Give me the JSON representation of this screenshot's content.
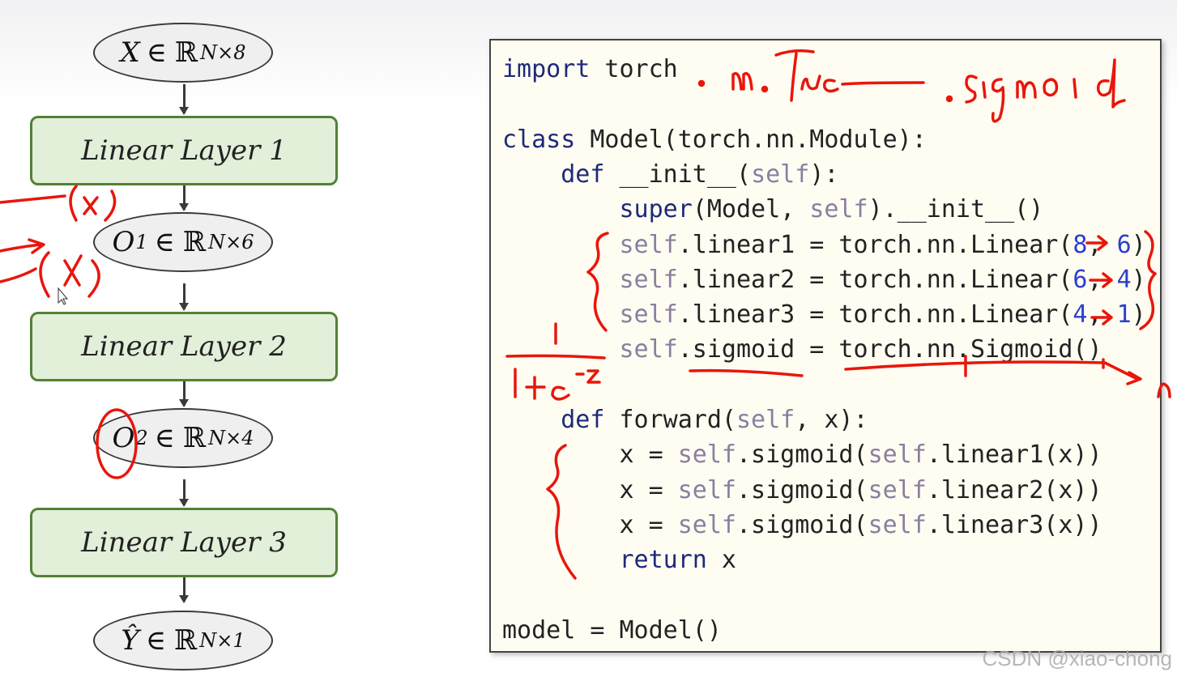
{
  "diagram": {
    "nodes": [
      {
        "symbol": "X",
        "exp_sup": "",
        "set": "ℝ",
        "dims": "N×8"
      },
      {
        "symbol": "O",
        "exp_sup": "1",
        "set": "ℝ",
        "dims": "N×6"
      },
      {
        "symbol": "O",
        "exp_sup": "2",
        "set": "ℝ",
        "dims": "N×4"
      },
      {
        "symbol": "Ŷ",
        "exp_sup": "",
        "set": "ℝ",
        "dims": "N×1"
      }
    ],
    "elem_symbol": "∈",
    "layers": [
      "Linear Layer 1",
      "Linear Layer 2",
      "Linear Layer 3"
    ]
  },
  "code": {
    "lines": [
      [
        {
          "t": "import",
          "c": "kw"
        },
        {
          "t": " torch",
          "c": ""
        }
      ],
      [],
      [
        {
          "t": "class",
          "c": "kw"
        },
        {
          "t": " Model(torch.nn.Module):",
          "c": ""
        }
      ],
      [
        {
          "t": "    ",
          "c": ""
        },
        {
          "t": "def",
          "c": "kw"
        },
        {
          "t": " __init__(",
          "c": ""
        },
        {
          "t": "self",
          "c": "slf"
        },
        {
          "t": "):",
          "c": ""
        }
      ],
      [
        {
          "t": "        ",
          "c": ""
        },
        {
          "t": "super",
          "c": "kw"
        },
        {
          "t": "(Model, ",
          "c": ""
        },
        {
          "t": "self",
          "c": "slf"
        },
        {
          "t": ").__init__()",
          "c": ""
        }
      ],
      [
        {
          "t": "        ",
          "c": ""
        },
        {
          "t": "self",
          "c": "slf"
        },
        {
          "t": ".linear1 = torch.nn.Linear(",
          "c": ""
        },
        {
          "t": "8",
          "c": "num"
        },
        {
          "t": ", ",
          "c": ""
        },
        {
          "t": "6",
          "c": "num"
        },
        {
          "t": ")",
          "c": ""
        }
      ],
      [
        {
          "t": "        ",
          "c": ""
        },
        {
          "t": "self",
          "c": "slf"
        },
        {
          "t": ".linear2 = torch.nn.Linear(",
          "c": ""
        },
        {
          "t": "6",
          "c": "num"
        },
        {
          "t": ", ",
          "c": ""
        },
        {
          "t": "4",
          "c": "num"
        },
        {
          "t": ")",
          "c": ""
        }
      ],
      [
        {
          "t": "        ",
          "c": ""
        },
        {
          "t": "self",
          "c": "slf"
        },
        {
          "t": ".linear3 = torch.nn.Linear(",
          "c": ""
        },
        {
          "t": "4",
          "c": "num"
        },
        {
          "t": ", ",
          "c": ""
        },
        {
          "t": "1",
          "c": "num"
        },
        {
          "t": ")",
          "c": ""
        }
      ],
      [
        {
          "t": "        ",
          "c": ""
        },
        {
          "t": "self",
          "c": "slf"
        },
        {
          "t": ".sigmoid = torch.nn.Sigmoid()",
          "c": ""
        }
      ],
      [],
      [
        {
          "t": "    ",
          "c": ""
        },
        {
          "t": "def",
          "c": "kw"
        },
        {
          "t": " forward(",
          "c": ""
        },
        {
          "t": "self",
          "c": "slf"
        },
        {
          "t": ", x):",
          "c": ""
        }
      ],
      [
        {
          "t": "        x = ",
          "c": ""
        },
        {
          "t": "self",
          "c": "slf"
        },
        {
          "t": ".sigmoid(",
          "c": ""
        },
        {
          "t": "self",
          "c": "slf"
        },
        {
          "t": ".linear1(x))",
          "c": ""
        }
      ],
      [
        {
          "t": "        x = ",
          "c": ""
        },
        {
          "t": "self",
          "c": "slf"
        },
        {
          "t": ".sigmoid(",
          "c": ""
        },
        {
          "t": "self",
          "c": "slf"
        },
        {
          "t": ".linear2(x))",
          "c": ""
        }
      ],
      [
        {
          "t": "        x = ",
          "c": ""
        },
        {
          "t": "self",
          "c": "slf"
        },
        {
          "t": ".sigmoid(",
          "c": ""
        },
        {
          "t": "self",
          "c": "slf"
        },
        {
          "t": ".linear3(x))",
          "c": ""
        }
      ],
      [
        {
          "t": "        ",
          "c": ""
        },
        {
          "t": "return",
          "c": "kw"
        },
        {
          "t": " x",
          "c": ""
        }
      ],
      [],
      [
        {
          "t": "model = Model()",
          "c": ""
        }
      ]
    ]
  },
  "annotations": {
    "handwritten_color": "#e8160c",
    "top_note": ". nn.Func——.sigmoid",
    "sigmoid_formula": "1 / (1+e^-z)"
  },
  "watermark": "CSDN @xiao-chong",
  "colors": {
    "layer_fill": "#e2efd9",
    "layer_border": "#538135",
    "ellipse_fill": "#efeff0",
    "code_bg": "#fffdf2",
    "keyword": "#1e2a78",
    "self": "#8a7fa0",
    "number": "#2b3fd0"
  }
}
